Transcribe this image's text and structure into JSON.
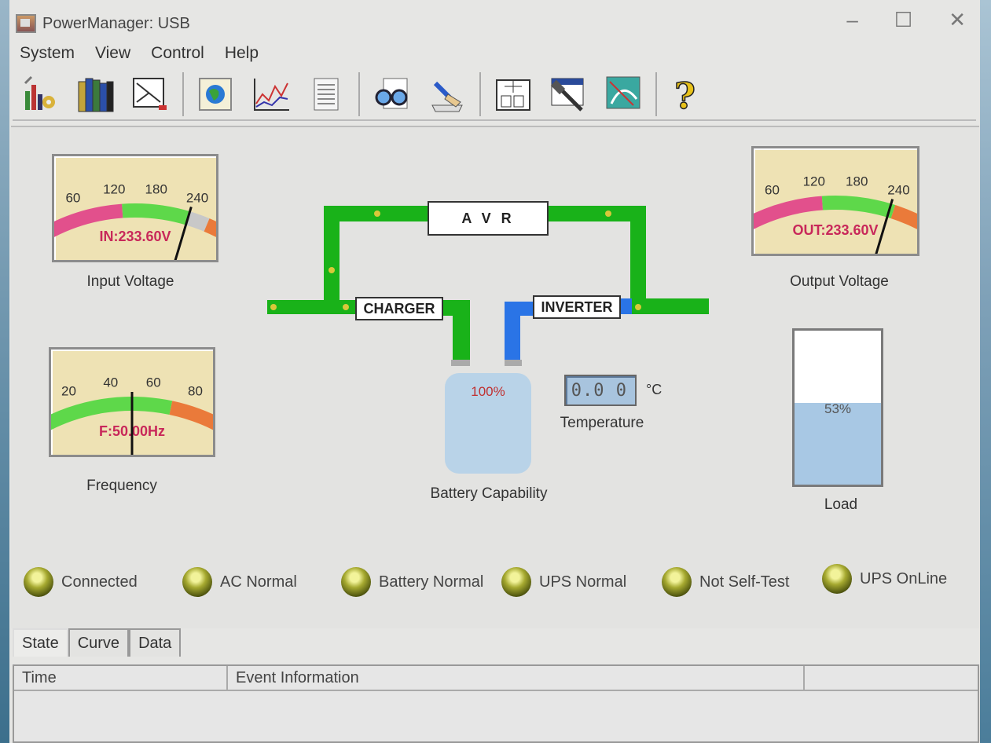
{
  "window": {
    "title": "PowerManager: USB",
    "min_symbol": "–",
    "max_symbol": "☐",
    "close_symbol": "✕"
  },
  "menu": [
    "System",
    "View",
    "Control",
    "Help"
  ],
  "toolbar": {
    "buttons": [
      "config-tools-icon",
      "books-icon",
      "schedule-edit-icon",
      "globe-icon",
      "chart-icon",
      "document-list-icon",
      "glasses-icon",
      "hand-writing-icon",
      "calendar-icon",
      "hammer-icon",
      "satellite-icon",
      "help-icon"
    ]
  },
  "input_meter": {
    "scale": [
      "0",
      "60",
      "120",
      "180",
      "240",
      "300"
    ],
    "readout": "IN:233.60V",
    "label": "Input Voltage",
    "value": 233.6,
    "min": 0,
    "max": 300
  },
  "output_meter": {
    "scale": [
      "0",
      "60",
      "120",
      "180",
      "240",
      "300"
    ],
    "readout": "OUT:233.60V",
    "label": "Output Voltage",
    "value": 233.6,
    "min": 0,
    "max": 300
  },
  "frequency_meter": {
    "scale": [
      "0",
      "20",
      "40",
      "60",
      "80",
      "100"
    ],
    "readout": "F:50.00Hz",
    "label": "Frequency",
    "value": 50.0,
    "min": 0,
    "max": 100
  },
  "diagram": {
    "avr": "A V R",
    "charger": "CHARGER",
    "inverter": "INVERTER"
  },
  "battery": {
    "percent": "100%",
    "label": "Battery Capability",
    "level": 1.0
  },
  "temperature": {
    "value": "0.0 0",
    "unit": "°C",
    "label": "Temperature"
  },
  "load": {
    "percent": "53%",
    "label": "Load",
    "level": 0.53
  },
  "status": [
    "Connected",
    "AC Normal",
    "Battery Normal",
    "UPS Normal",
    "Not Self-Test",
    "UPS OnLine"
  ],
  "tabs": [
    "State",
    "Curve",
    "Data"
  ],
  "log": {
    "columns": [
      "Time",
      "Event Information",
      ""
    ]
  },
  "colors": {
    "bus_green": "#19b219",
    "inverter_blue": "#2a74e6",
    "readout_red": "#c8285a",
    "gauge_pink": "#e2508c",
    "gauge_green": "#5ed84a",
    "gauge_orange": "#ea7a3a"
  }
}
